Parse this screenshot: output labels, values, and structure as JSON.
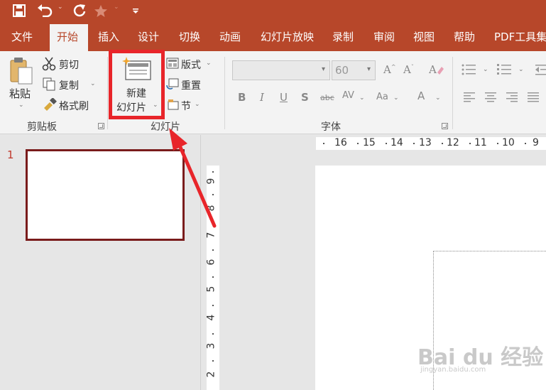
{
  "quick_access": {
    "save_icon": "save-icon",
    "undo_icon": "undo-icon",
    "redo_icon": "redo-icon",
    "star_icon": "star-icon",
    "customize_icon": "customize-qat-icon"
  },
  "tabs": [
    "文件",
    "开始",
    "插入",
    "设计",
    "切换",
    "动画",
    "幻灯片放映",
    "录制",
    "审阅",
    "视图",
    "帮助",
    "PDF工具集"
  ],
  "ribbon": {
    "clipboard": {
      "paste": "粘贴",
      "cut": "剪切",
      "copy": "复制",
      "format_painter": "格式刷",
      "label": "剪贴板"
    },
    "slides": {
      "new_slide_line1": "新建",
      "new_slide_line2": "幻灯片",
      "layout": "版式",
      "reset": "重置",
      "section": "节",
      "label": "幻灯片"
    },
    "font": {
      "font_name": "",
      "font_size": "60",
      "label": "字体"
    }
  },
  "slide_panel": {
    "slide_number": "1"
  },
  "rulers": {
    "horizontal": [
      "16",
      "15",
      "14",
      "13",
      "12",
      "11",
      "10",
      "9"
    ],
    "vertical": [
      "9",
      "8",
      "7",
      "6",
      "5",
      "4",
      "3",
      "2"
    ]
  },
  "watermark": {
    "brand": "Bai du 经验",
    "url": "jingyan.baidu.com"
  },
  "colors": {
    "accent": "#b7472a",
    "highlight": "#e8252a"
  }
}
